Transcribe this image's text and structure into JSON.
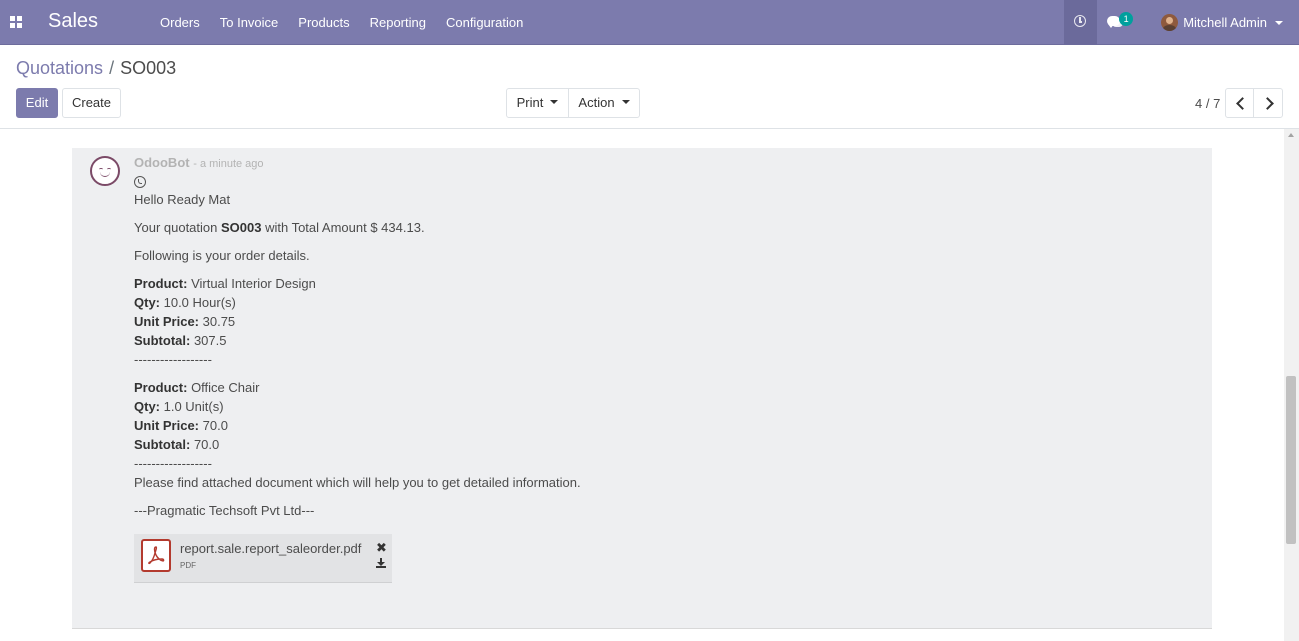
{
  "navbar": {
    "app_name": "Sales",
    "menu": [
      "Orders",
      "To Invoice",
      "Products",
      "Reporting",
      "Configuration"
    ],
    "chat_count": "1",
    "user_name": "Mitchell Admin",
    "bg_color": "#7c7bad"
  },
  "breadcrumb": {
    "parent": "Quotations",
    "separator": "/",
    "current": "SO003"
  },
  "buttons": {
    "edit": "Edit",
    "create": "Create",
    "print": "Print",
    "action": "Action"
  },
  "pager": {
    "value": "4 / 7"
  },
  "message": {
    "author": "OdooBot",
    "date": "- a minute ago",
    "greeting": "Hello Ready Mat",
    "quote_prefix": "Your quotation ",
    "quote_ref": "SO003",
    "quote_suffix": " with Total Amount $ 434.13.",
    "details_intro": "Following is your order details.",
    "lines": [
      {
        "product_label": "Product:",
        "product": " Virtual Interior Design",
        "qty_label": "Qty:",
        "qty": " 10.0 Hour(s)",
        "price_label": "Unit Price:",
        "price": " 30.75",
        "subtotal_label": "Subtotal:",
        "subtotal": " 307.5"
      },
      {
        "product_label": "Product:",
        "product": " Office Chair",
        "qty_label": "Qty:",
        "qty": " 1.0 Unit(s)",
        "price_label": "Unit Price:",
        "price": " 70.0",
        "subtotal_label": "Subtotal:",
        "subtotal": " 70.0"
      }
    ],
    "divider": "------------------",
    "closing": "Please find attached document which will help you to get detailed information.",
    "signature": "---Pragmatic Techsoft Pvt Ltd---",
    "attachment": {
      "name": "report.sale.report_saleorder.pdf",
      "ext": "PDF",
      "remove_glyph": "✖"
    }
  }
}
